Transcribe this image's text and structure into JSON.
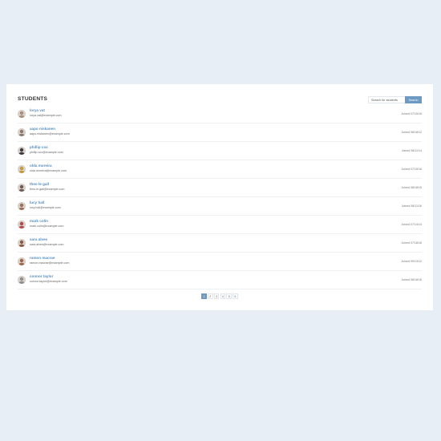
{
  "card": {
    "title": "STUDENTS",
    "search": {
      "placeholder": "Search for students",
      "button_label": "Search"
    }
  },
  "students": [
    {
      "name": "lorya vat",
      "email": "lorya.vat@example.com",
      "joined": "Joined 07/15/16",
      "avatar_color": "#a78f7d"
    },
    {
      "name": "aapo niskanen",
      "email": "aapo.niskanen@example.com",
      "joined": "Joined 08/18/12",
      "avatar_color": "#8a7b6f"
    },
    {
      "name": "phillip cox",
      "email": "phillip.cox@example.com",
      "joined": "Joined 08/11/14",
      "avatar_color": "#3b3a40"
    },
    {
      "name": "olda moreira",
      "email": "olda.moreira@example.com",
      "joined": "Joined 07/15/16",
      "avatar_color": "#c29a3e"
    },
    {
      "name": "theo le gall",
      "email": "theo.le.gall@example.com",
      "joined": "Joined 08/18/15",
      "avatar_color": "#6b5c55"
    },
    {
      "name": "lucy hall",
      "email": "lucy.hall@example.com",
      "joined": "Joined 08/11/16",
      "avatar_color": "#9c6f59"
    },
    {
      "name": "mark colin",
      "email": "mark.colin@example.com",
      "joined": "Joined 07/14/14",
      "avatar_color": "#b24a4a"
    },
    {
      "name": "sara alves",
      "email": "sara.alves@example.com",
      "joined": "Joined 07/18/16",
      "avatar_color": "#8b5a44"
    },
    {
      "name": "ramon macrae",
      "email": "ramon.macrae@example.com",
      "joined": "Joined 09/13/12",
      "avatar_color": "#a0654b"
    },
    {
      "name": "connor taylor",
      "email": "connor.taylor@example.com",
      "joined": "Joined 08/18/16",
      "avatar_color": "#8f8f8f"
    }
  ],
  "pagination": {
    "pages": [
      "1",
      "2",
      "3",
      "4",
      "5",
      "6"
    ],
    "active": "1"
  }
}
